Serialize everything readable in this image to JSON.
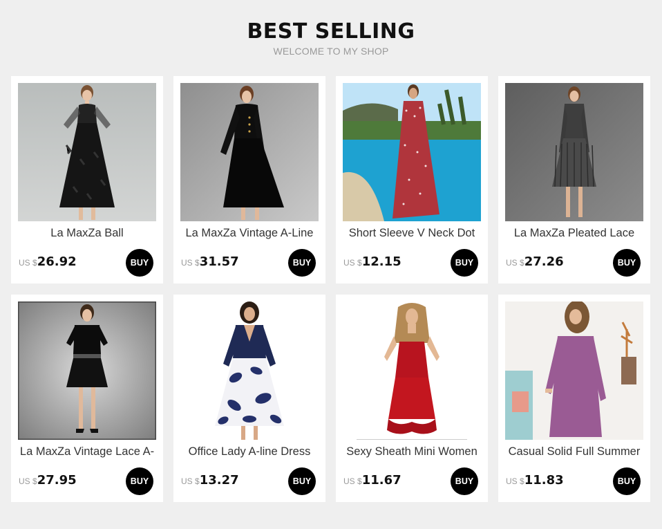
{
  "header": {
    "title": "BEST SELLING",
    "subtitle": "WELCOME TO MY SHOP"
  },
  "buy_label": "BUY",
  "products": [
    {
      "name": "La MaxZa Ball",
      "currency": "US $",
      "price": "26.92",
      "image": "black-tassel-lace-dress"
    },
    {
      "name": "La MaxZa Vintage A-Line",
      "currency": "US $",
      "price": "31.57",
      "image": "black-velvet-a-line-dress"
    },
    {
      "name": "Short Sleeve V Neck Dot",
      "currency": "US $",
      "price": "12.15",
      "image": "red-polka-dot-maxi-dress-pool"
    },
    {
      "name": "La MaxZa Pleated Lace",
      "currency": "US $",
      "price": "27.26",
      "image": "grey-pleated-lace-dress"
    },
    {
      "name": "La MaxZa Vintage Lace A-",
      "currency": "US $",
      "price": "27.95",
      "image": "black-lace-short-dress"
    },
    {
      "name": "Office Lady A-line Dress",
      "currency": "US $",
      "price": "13.27",
      "image": "navy-floral-office-dress"
    },
    {
      "name": "Sexy Sheath Mini Women",
      "currency": "US $",
      "price": "11.67",
      "image": "red-satin-mini-dress"
    },
    {
      "name": "Casual Solid Full Summer",
      "currency": "US $",
      "price": "11.83",
      "image": "purple-long-sleeve-dress"
    }
  ]
}
